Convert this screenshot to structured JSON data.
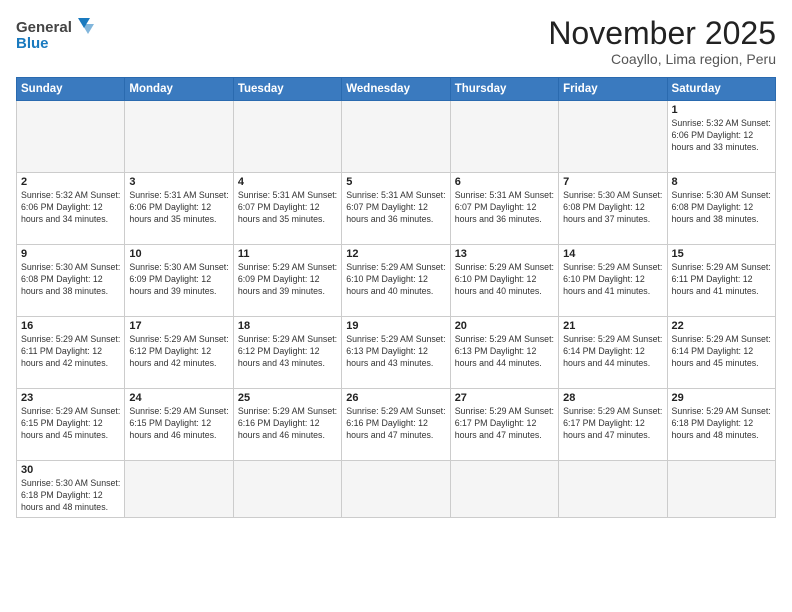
{
  "header": {
    "logo_general": "General",
    "logo_blue": "Blue",
    "title": "November 2025",
    "subtitle": "Coayllo, Lima region, Peru"
  },
  "weekdays": [
    "Sunday",
    "Monday",
    "Tuesday",
    "Wednesday",
    "Thursday",
    "Friday",
    "Saturday"
  ],
  "weeks": [
    [
      {
        "day": "",
        "info": ""
      },
      {
        "day": "",
        "info": ""
      },
      {
        "day": "",
        "info": ""
      },
      {
        "day": "",
        "info": ""
      },
      {
        "day": "",
        "info": ""
      },
      {
        "day": "",
        "info": ""
      },
      {
        "day": "1",
        "info": "Sunrise: 5:32 AM\nSunset: 6:06 PM\nDaylight: 12 hours\nand 33 minutes."
      }
    ],
    [
      {
        "day": "2",
        "info": "Sunrise: 5:32 AM\nSunset: 6:06 PM\nDaylight: 12 hours\nand 34 minutes."
      },
      {
        "day": "3",
        "info": "Sunrise: 5:31 AM\nSunset: 6:06 PM\nDaylight: 12 hours\nand 35 minutes."
      },
      {
        "day": "4",
        "info": "Sunrise: 5:31 AM\nSunset: 6:07 PM\nDaylight: 12 hours\nand 35 minutes."
      },
      {
        "day": "5",
        "info": "Sunrise: 5:31 AM\nSunset: 6:07 PM\nDaylight: 12 hours\nand 36 minutes."
      },
      {
        "day": "6",
        "info": "Sunrise: 5:31 AM\nSunset: 6:07 PM\nDaylight: 12 hours\nand 36 minutes."
      },
      {
        "day": "7",
        "info": "Sunrise: 5:30 AM\nSunset: 6:08 PM\nDaylight: 12 hours\nand 37 minutes."
      },
      {
        "day": "8",
        "info": "Sunrise: 5:30 AM\nSunset: 6:08 PM\nDaylight: 12 hours\nand 38 minutes."
      }
    ],
    [
      {
        "day": "9",
        "info": "Sunrise: 5:30 AM\nSunset: 6:08 PM\nDaylight: 12 hours\nand 38 minutes."
      },
      {
        "day": "10",
        "info": "Sunrise: 5:30 AM\nSunset: 6:09 PM\nDaylight: 12 hours\nand 39 minutes."
      },
      {
        "day": "11",
        "info": "Sunrise: 5:29 AM\nSunset: 6:09 PM\nDaylight: 12 hours\nand 39 minutes."
      },
      {
        "day": "12",
        "info": "Sunrise: 5:29 AM\nSunset: 6:10 PM\nDaylight: 12 hours\nand 40 minutes."
      },
      {
        "day": "13",
        "info": "Sunrise: 5:29 AM\nSunset: 6:10 PM\nDaylight: 12 hours\nand 40 minutes."
      },
      {
        "day": "14",
        "info": "Sunrise: 5:29 AM\nSunset: 6:10 PM\nDaylight: 12 hours\nand 41 minutes."
      },
      {
        "day": "15",
        "info": "Sunrise: 5:29 AM\nSunset: 6:11 PM\nDaylight: 12 hours\nand 41 minutes."
      }
    ],
    [
      {
        "day": "16",
        "info": "Sunrise: 5:29 AM\nSunset: 6:11 PM\nDaylight: 12 hours\nand 42 minutes."
      },
      {
        "day": "17",
        "info": "Sunrise: 5:29 AM\nSunset: 6:12 PM\nDaylight: 12 hours\nand 42 minutes."
      },
      {
        "day": "18",
        "info": "Sunrise: 5:29 AM\nSunset: 6:12 PM\nDaylight: 12 hours\nand 43 minutes."
      },
      {
        "day": "19",
        "info": "Sunrise: 5:29 AM\nSunset: 6:13 PM\nDaylight: 12 hours\nand 43 minutes."
      },
      {
        "day": "20",
        "info": "Sunrise: 5:29 AM\nSunset: 6:13 PM\nDaylight: 12 hours\nand 44 minutes."
      },
      {
        "day": "21",
        "info": "Sunrise: 5:29 AM\nSunset: 6:14 PM\nDaylight: 12 hours\nand 44 minutes."
      },
      {
        "day": "22",
        "info": "Sunrise: 5:29 AM\nSunset: 6:14 PM\nDaylight: 12 hours\nand 45 minutes."
      }
    ],
    [
      {
        "day": "23",
        "info": "Sunrise: 5:29 AM\nSunset: 6:15 PM\nDaylight: 12 hours\nand 45 minutes."
      },
      {
        "day": "24",
        "info": "Sunrise: 5:29 AM\nSunset: 6:15 PM\nDaylight: 12 hours\nand 46 minutes."
      },
      {
        "day": "25",
        "info": "Sunrise: 5:29 AM\nSunset: 6:16 PM\nDaylight: 12 hours\nand 46 minutes."
      },
      {
        "day": "26",
        "info": "Sunrise: 5:29 AM\nSunset: 6:16 PM\nDaylight: 12 hours\nand 47 minutes."
      },
      {
        "day": "27",
        "info": "Sunrise: 5:29 AM\nSunset: 6:17 PM\nDaylight: 12 hours\nand 47 minutes."
      },
      {
        "day": "28",
        "info": "Sunrise: 5:29 AM\nSunset: 6:17 PM\nDaylight: 12 hours\nand 47 minutes."
      },
      {
        "day": "29",
        "info": "Sunrise: 5:29 AM\nSunset: 6:18 PM\nDaylight: 12 hours\nand 48 minutes."
      }
    ],
    [
      {
        "day": "30",
        "info": "Sunrise: 5:30 AM\nSunset: 6:18 PM\nDaylight: 12 hours\nand 48 minutes."
      },
      {
        "day": "",
        "info": ""
      },
      {
        "day": "",
        "info": ""
      },
      {
        "day": "",
        "info": ""
      },
      {
        "day": "",
        "info": ""
      },
      {
        "day": "",
        "info": ""
      },
      {
        "day": "",
        "info": ""
      }
    ]
  ]
}
